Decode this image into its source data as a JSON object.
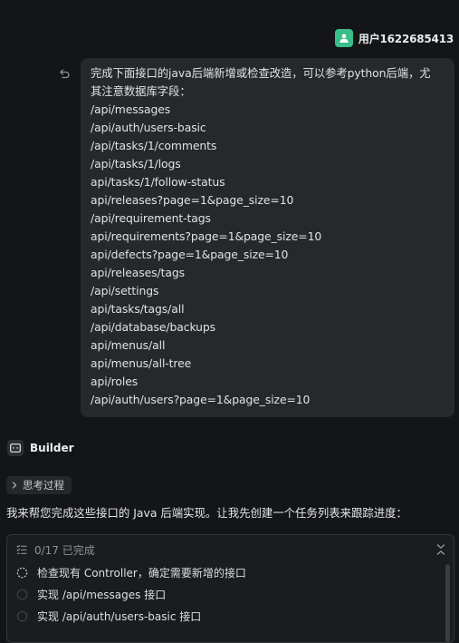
{
  "user": {
    "name": "用户1622685413",
    "avatar_icon": "user-avatar-icon",
    "avatar_color": "#3bbd8a"
  },
  "message": {
    "lines": [
      "完成下面接口的java后端新增或检查改造，可以参考python后端，尤",
      "其注意数据库字段：",
      "/api/messages",
      "/api/auth/users-basic",
      "/api/tasks/1/comments",
      "/api/tasks/1/logs",
      "api/tasks/1/follow-status",
      "api/releases?page=1&page_size=10",
      "/api/requirement-tags",
      "api/requirements?page=1&page_size=10",
      "api/defects?page=1&page_size=10",
      "api/releases/tags",
      "/api/settings",
      "api/tasks/tags/all",
      "/api/database/backups",
      "api/menus/all",
      "api/menus/all-tree",
      "api/roles",
      "/api/auth/users?page=1&page_size=10"
    ]
  },
  "assistant": {
    "name": "Builder",
    "thinking_label": "思考过程",
    "intro": "我来帮您完成这些接口的 Java 后端实现。让我先创建一个任务列表来跟踪进度："
  },
  "tasks": {
    "progress": "0/17 已完成",
    "items": [
      {
        "label": "检查现有 Controller，确定需要新增的接口",
        "status": "in-progress"
      },
      {
        "label": "实现 /api/messages 接口",
        "status": "pending"
      },
      {
        "label": "实现 /api/auth/users-basic 接口",
        "status": "pending"
      }
    ]
  }
}
